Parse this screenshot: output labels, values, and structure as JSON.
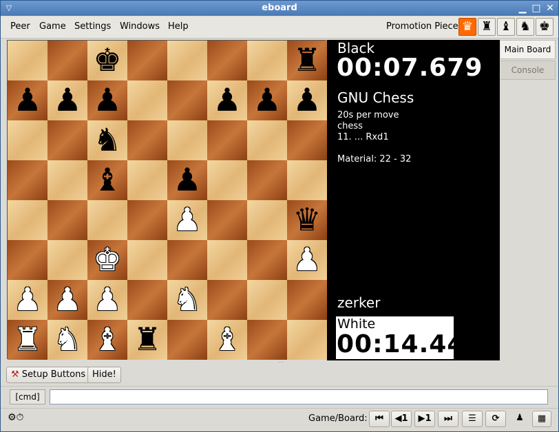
{
  "window": {
    "title": "eboard",
    "menu_icon": "window-menu-icon",
    "minimize": "▁",
    "maximize": "□",
    "close": "✕"
  },
  "menubar": {
    "items": [
      {
        "label": "Peer"
      },
      {
        "label": "Game"
      },
      {
        "label": "Settings"
      },
      {
        "label": "Windows"
      },
      {
        "label": "Help"
      }
    ],
    "promotion_label": "Promotion Piece",
    "promotion_pieces": [
      {
        "glyph": "♛",
        "name": "queen",
        "active": true
      },
      {
        "glyph": "♜",
        "name": "rook",
        "active": false
      },
      {
        "glyph": "♝",
        "name": "bishop",
        "active": false
      },
      {
        "glyph": "♞",
        "name": "knight",
        "active": false
      },
      {
        "glyph": "♚",
        "name": "king",
        "active": false
      }
    ]
  },
  "board": {
    "light_color": "#eac48a",
    "dark_color": "#a8592a",
    "ranks": [
      [
        "",
        "",
        "k",
        "",
        "",
        "",
        "",
        "r"
      ],
      [
        "p",
        "p",
        "p",
        "",
        "",
        "p",
        "p",
        "p"
      ],
      [
        "",
        "",
        "n",
        "",
        "",
        "",
        "",
        ""
      ],
      [
        "",
        "",
        "b",
        "",
        "p",
        "",
        "",
        ""
      ],
      [
        "",
        "",
        "",
        "",
        "P",
        "",
        "",
        "q"
      ],
      [
        "",
        "",
        "K",
        "",
        "",
        "",
        "",
        "P"
      ],
      [
        "P",
        "P",
        "P",
        "",
        "N",
        "",
        "",
        ""
      ],
      [
        "R",
        "N",
        "B",
        "r",
        "",
        "B",
        "",
        ""
      ]
    ]
  },
  "info": {
    "black_label": "Black",
    "black_clock": "00:07.679",
    "opponent": "GNU Chess",
    "time_control": "20s per move",
    "variant": "chess",
    "last_move": "11. ... Rxd1",
    "material": "Material: 22 - 32",
    "player": "zerker",
    "white_label": "White",
    "white_clock": "00:14.44"
  },
  "sidetabs": [
    {
      "label": "Main Board",
      "active": true
    },
    {
      "label": "Console",
      "active": false
    }
  ],
  "buttons": {
    "setup": "Setup Buttons",
    "hide": "Hide!"
  },
  "command": {
    "label": "[cmd]",
    "value": ""
  },
  "status": {
    "game_board_label": "Game/Board:",
    "nav": {
      "first": "⏮",
      "prev": "◀1",
      "next": "▶1",
      "last": "⏭"
    }
  }
}
